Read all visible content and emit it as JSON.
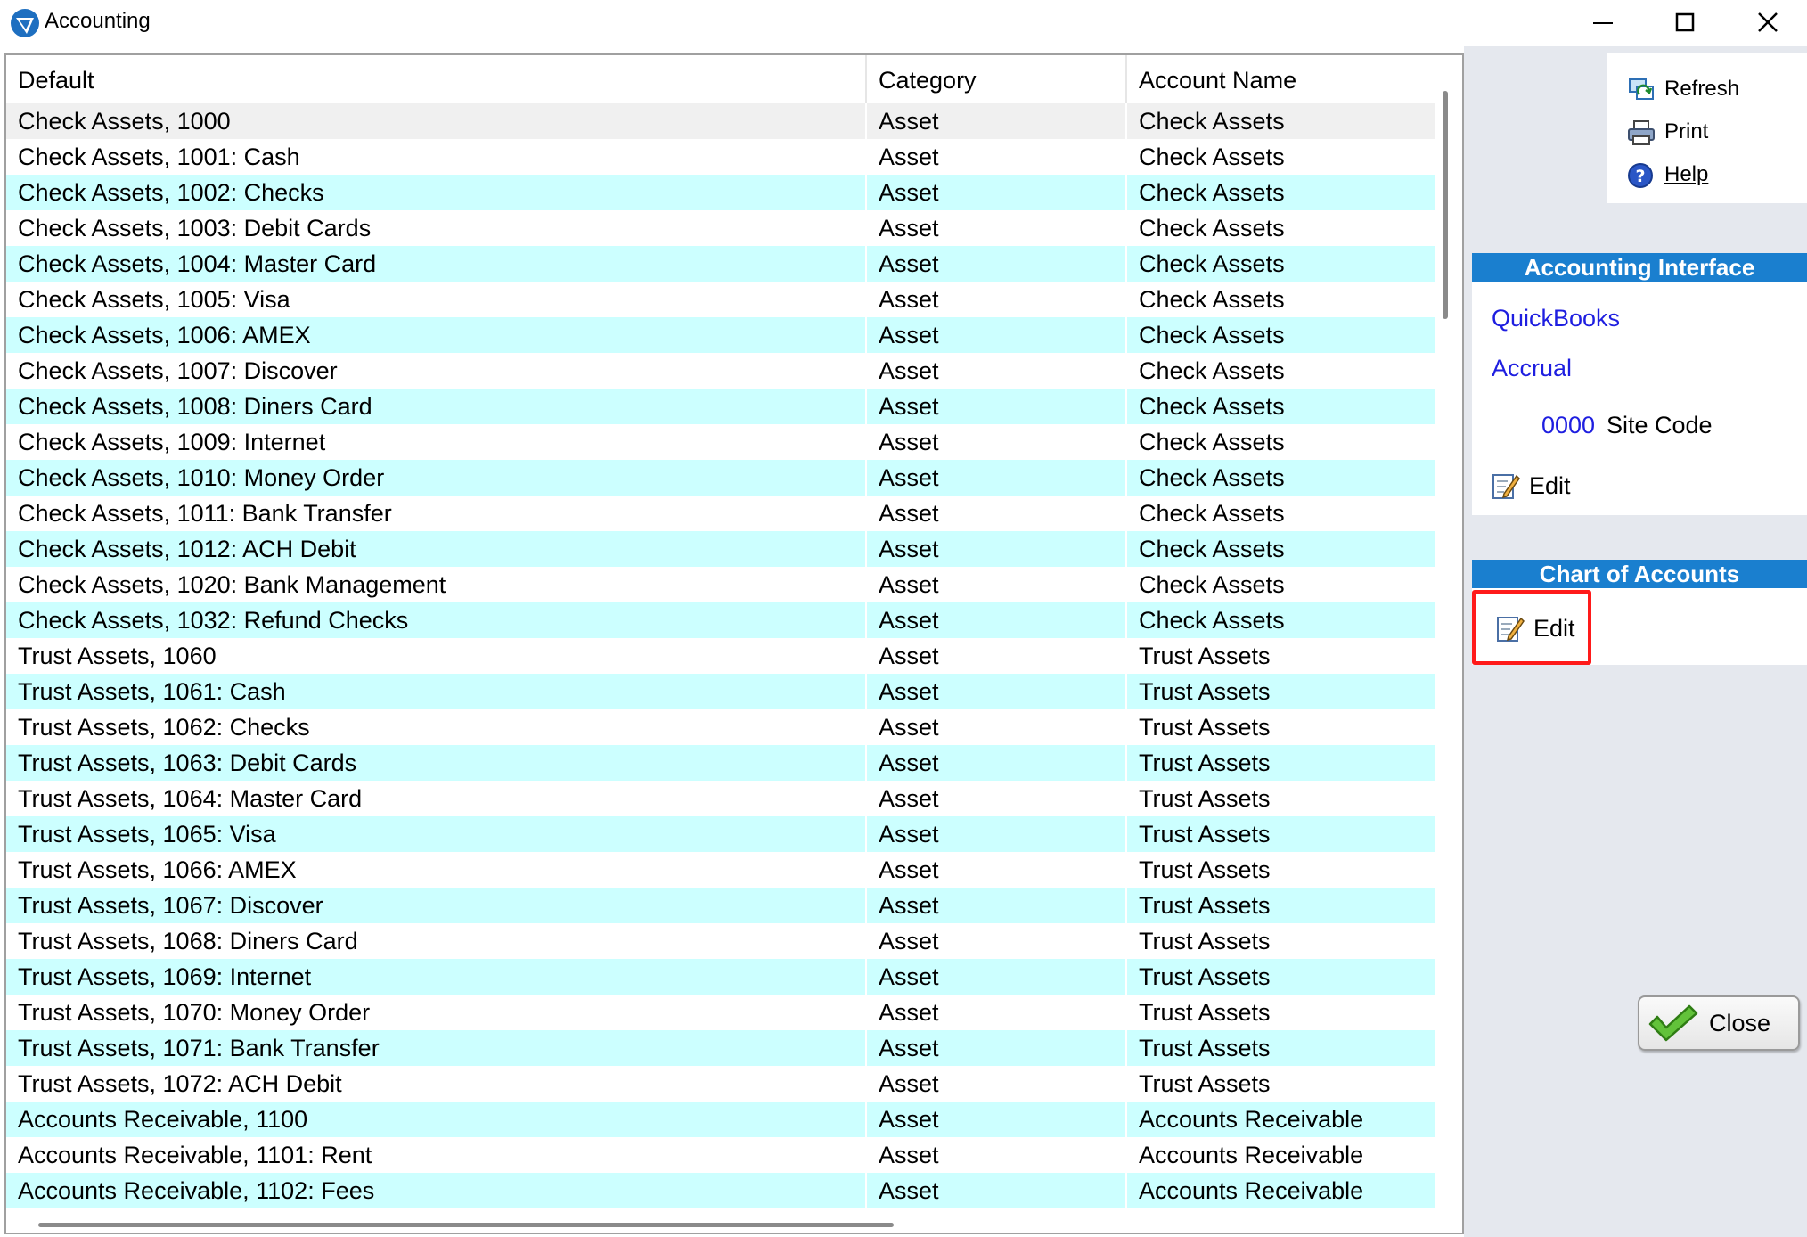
{
  "window": {
    "title": "Accounting"
  },
  "grid": {
    "columns": [
      "Default",
      "Category",
      "Account Name"
    ],
    "rows": [
      [
        "Check Assets, 1000",
        "Asset",
        "Check Assets"
      ],
      [
        "Check Assets, 1001: Cash",
        "Asset",
        "Check Assets"
      ],
      [
        "Check Assets, 1002: Checks",
        "Asset",
        "Check Assets"
      ],
      [
        "Check Assets, 1003: Debit Cards",
        "Asset",
        "Check Assets"
      ],
      [
        "Check Assets, 1004: Master Card",
        "Asset",
        "Check Assets"
      ],
      [
        "Check Assets, 1005: Visa",
        "Asset",
        "Check Assets"
      ],
      [
        "Check Assets, 1006: AMEX",
        "Asset",
        "Check Assets"
      ],
      [
        "Check Assets, 1007: Discover",
        "Asset",
        "Check Assets"
      ],
      [
        "Check Assets, 1008: Diners Card",
        "Asset",
        "Check Assets"
      ],
      [
        "Check Assets, 1009: Internet",
        "Asset",
        "Check Assets"
      ],
      [
        "Check Assets, 1010: Money Order",
        "Asset",
        "Check Assets"
      ],
      [
        "Check Assets, 1011: Bank Transfer",
        "Asset",
        "Check Assets"
      ],
      [
        "Check Assets, 1012: ACH Debit",
        "Asset",
        "Check Assets"
      ],
      [
        "Check Assets, 1020: Bank Management",
        "Asset",
        "Check Assets"
      ],
      [
        "Check Assets, 1032: Refund Checks",
        "Asset",
        "Check Assets"
      ],
      [
        "Trust Assets, 1060",
        "Asset",
        "Trust Assets"
      ],
      [
        "Trust Assets, 1061: Cash",
        "Asset",
        "Trust Assets"
      ],
      [
        "Trust Assets, 1062: Checks",
        "Asset",
        "Trust Assets"
      ],
      [
        "Trust Assets, 1063: Debit Cards",
        "Asset",
        "Trust Assets"
      ],
      [
        "Trust Assets, 1064: Master Card",
        "Asset",
        "Trust Assets"
      ],
      [
        "Trust Assets, 1065: Visa",
        "Asset",
        "Trust Assets"
      ],
      [
        "Trust Assets, 1066: AMEX",
        "Asset",
        "Trust Assets"
      ],
      [
        "Trust Assets, 1067: Discover",
        "Asset",
        "Trust Assets"
      ],
      [
        "Trust Assets, 1068: Diners Card",
        "Asset",
        "Trust Assets"
      ],
      [
        "Trust Assets, 1069: Internet",
        "Asset",
        "Trust Assets"
      ],
      [
        "Trust Assets, 1070: Money Order",
        "Asset",
        "Trust Assets"
      ],
      [
        "Trust Assets, 1071: Bank Transfer",
        "Asset",
        "Trust Assets"
      ],
      [
        "Trust Assets, 1072: ACH Debit",
        "Asset",
        "Trust Assets"
      ],
      [
        "Accounts Receivable, 1100",
        "Asset",
        "Accounts Receivable"
      ],
      [
        "Accounts Receivable, 1101: Rent",
        "Asset",
        "Accounts Receivable"
      ],
      [
        "Accounts Receivable, 1102: Fees",
        "Asset",
        "Accounts Receivable"
      ]
    ],
    "selected_row": 0,
    "colors": {
      "row_selected": "#f0f0f0",
      "row_white": "#ffffff",
      "row_alt": "#ccffff"
    }
  },
  "toolbar": {
    "refresh_label": "Refresh",
    "print_label": "Print",
    "help_label": "Help"
  },
  "accounting_interface": {
    "header": "Accounting Interface",
    "software": "QuickBooks",
    "method": "Accrual",
    "site_code_value": "0000",
    "site_code_label": "Site Code",
    "edit_label": "Edit"
  },
  "chart_of_accounts": {
    "header": "Chart of Accounts",
    "edit_label": "Edit"
  },
  "close_button": {
    "label": "Close"
  },
  "icons": {
    "app": "accounting-app-icon",
    "refresh": "refresh-icon",
    "print": "printer-icon",
    "help": "help-icon",
    "edit": "edit-pencil-icon",
    "close": "checkmark-icon"
  },
  "theme": {
    "accent": "#1a7fcf",
    "link": "#1e1ee0",
    "highlight": "#ff1a1a",
    "pane_bg": "#e5e8ee"
  }
}
